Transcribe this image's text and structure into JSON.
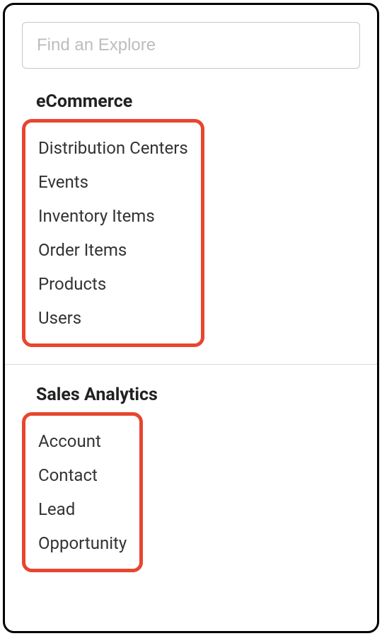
{
  "search": {
    "placeholder": "Find an Explore"
  },
  "sections": [
    {
      "title": "eCommerce",
      "items": [
        "Distribution Centers",
        "Events",
        "Inventory Items",
        "Order Items",
        "Products",
        "Users"
      ]
    },
    {
      "title": "Sales Analytics",
      "items": [
        "Account",
        "Contact",
        "Lead",
        "Opportunity"
      ]
    }
  ]
}
